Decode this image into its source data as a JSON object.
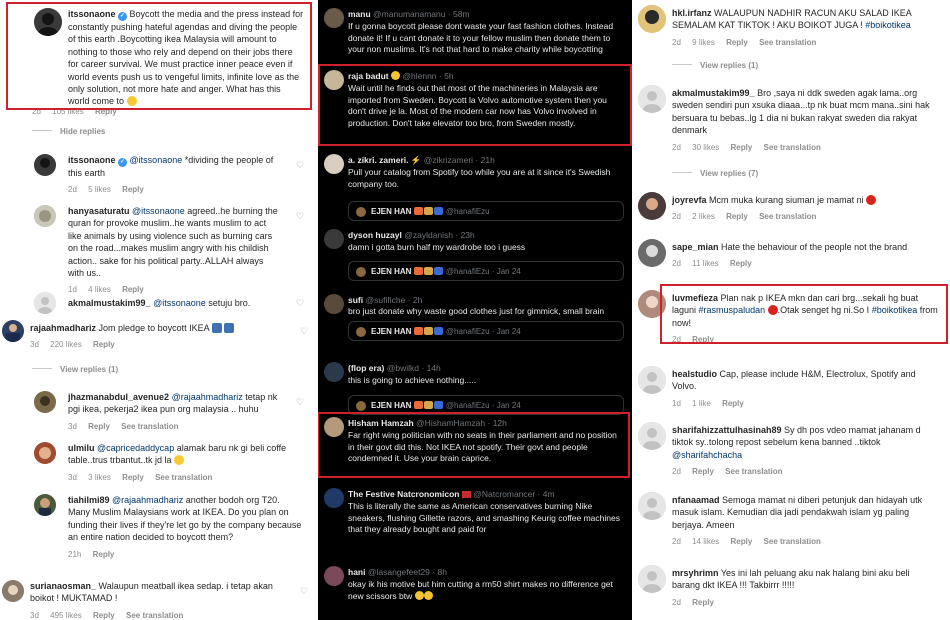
{
  "left": {
    "comments": [
      {
        "user": "itssonaone",
        "verified": true,
        "text": "Boycott the media and the press instead for constantly pushing hateful agendas and diving the people of this earth .Boycotting ikea Malaysia will amount to nothing to those who rely and depend on their jobs there for career survival. We must practice inner peace even if world events push us to vengeful limits, infinite love as the only solution, not more hate and anger. What has this world come to",
        "time": "2d",
        "likes": "105 likes",
        "reply": "Reply"
      },
      {
        "user": "itssonaone",
        "verified": true,
        "mention": "@itssonaone",
        "text": "*dividing the people of this earth",
        "time": "2d",
        "likes": "5 likes",
        "reply": "Reply"
      },
      {
        "user": "hanyasaturatu",
        "mention": "@itssonaone",
        "text": "agreed..he burning the quran for provoke muslim..he wants muslim to act like animals by using violence such as burning cars on the road...makes muslim angry with his childish action.. sake for his political party..ALLAH always with us..",
        "time": "1d",
        "likes": "4 likes",
        "reply": "Reply"
      },
      {
        "user": "akmalmustakim99_",
        "mention": "@itssonaone",
        "text": "setuju bro.",
        "time": "",
        "likes": "",
        "reply": ""
      },
      {
        "user": "rajaahmadhariz",
        "text": "Jom pledge to boycott IKEA",
        "time": "3d",
        "likes": "220 likes",
        "reply": "Reply"
      },
      {
        "user": "jhazmanabdul_avenue2",
        "mention": "@rajaahmadhariz",
        "text": "tetap nk pgi ikea, pekerja2 ikea pun org malaysia .. huhu",
        "time": "3d",
        "likes": "",
        "reply": "Reply",
        "extra": "See translation"
      },
      {
        "user": "ulmilu",
        "mention": "@capricedaddycap",
        "text": "alamak baru nk gi beli coffe table..trus trbantut..tk jd la",
        "time": "3d",
        "likes": "3 likes",
        "reply": "Reply",
        "extra": "See translation"
      },
      {
        "user": "tiahilmi89",
        "mention": "@rajaahmadhariz",
        "text": "another bodoh org T20. Many Muslim Malaysians work at IKEA. Do you plan on funding their lives if they're let go by the company because an entire nation decided to boycott them?",
        "time": "21h",
        "likes": "",
        "reply": "Reply"
      },
      {
        "user": "surianaosman_",
        "text": "Walaupun meatball ikea sedap. i tetap akan boikot ! MUKTAMAD !",
        "time": "3d",
        "likes": "495 likes",
        "reply": "Reply",
        "extra": "See translation"
      }
    ],
    "hide_replies": "Hide replies",
    "view_replies": "View replies (1)"
  },
  "mid": {
    "tweets": [
      {
        "name": "manu",
        "handle": "@manumanamanu",
        "time": "58m",
        "text": "If u gonna boycott please dont waste your fast fashion clothes. Instead donate it! If u cant donate it to your fellow muslim then donate them to your non muslims. It's not that hard to make charity while boycotting"
      },
      {
        "name": "raja badut",
        "handle": "@hlennn",
        "time": "5h",
        "text": "Wait until he finds out that most of the machineries in Malaysia are imported from Sweden. Boycott la Volvo automotive system then you don't drive je la. Most of the modern car now has Volvo involved in production. Don't take elevator too bro, from Sweden mostly."
      },
      {
        "name": "a. zikri. zameri.",
        "handle": "@zikrizameri",
        "time": "21h",
        "text": "Pull your catalog from Spotify too while you are at it since it's Swedish company too."
      },
      {
        "name": "dyson huzayl",
        "handle": "@zayldanish",
        "time": "23h",
        "text": "damn i gotta burn half my wardrobe too i guess"
      },
      {
        "name": "sufi",
        "handle": "@sufifiche",
        "time": "2h",
        "text": "bro just donate why waste good clothes just for gimmick, small brain"
      },
      {
        "name": "(flop era)",
        "handle": "@bwilkd",
        "time": "14h",
        "text": "this is going to achieve nothing....."
      },
      {
        "name": "Hisham Hamzah",
        "handle": "@HishamHamzah",
        "time": "12h",
        "text": "Far right wing politician with no seats in their parliament and no position in their govt did this. Not IKEA not spotify. Their govt and people condemned it. Use your brain caprice."
      },
      {
        "name": "The Festive Natcronomicon",
        "handle": "@Natcromancer",
        "time": "4m",
        "text": "This is literally the same as American conservatives burning Nike sneakers, flushing Gillette razors, and smashing Keurig coffee machines that they already bought and paid for"
      },
      {
        "name": "hani",
        "handle": "@lasangefeet29",
        "time": "8h",
        "text": "okay ik his motive but him cutting a rm50 shirt makes no difference get new scissors btw"
      }
    ],
    "quote": {
      "name": "EJEN HAN",
      "handle": "@hanafiEzu",
      "time": "Jan 24"
    }
  },
  "right": {
    "comments": [
      {
        "user": "hkl.irfanz",
        "text": "WALAUPUN NADHIR RACUN AKU SALAD IKEA SEMALAM KAT TIKTOK ! AKU BOIKOT JUGA !",
        "tag": "#boikotikea",
        "time": "2d",
        "likes": "9 likes",
        "reply": "Reply",
        "extra": "See translation"
      },
      {
        "user": "akmalmustakim99_",
        "text": "Bro ,saya ni ddk sweden agak lama..org sweden sendiri pun xsuka diaaa...tp nk buat mcm mana..sini hak bersuara tu bebas..lg 1 dia ni bukan rakyat sweden dia rakyat denmark",
        "time": "2d",
        "likes": "30 likes",
        "reply": "Reply",
        "extra": "See translation"
      },
      {
        "user": "joyrevfa",
        "text": "Mcm muka kurang siuman je mamat ni",
        "time": "2d",
        "likes": "2 likes",
        "reply": "Reply",
        "extra": "See translation"
      },
      {
        "user": "sape_mian",
        "text": "Hate the behaviour of the people not the brand",
        "time": "2d",
        "likes": "11 likes",
        "reply": "Reply"
      },
      {
        "user": "luvmefieza",
        "text": "Plan nak p IKEA mkn dan cari brg...sekali hg buat laguni",
        "tag": "#rasmuspaludan",
        "text2": ".Otak senget hg ni.So I",
        "tag2": "#boikotikea",
        "text3": "from now!",
        "time": "2d",
        "likes": "",
        "reply": "Reply"
      },
      {
        "user": "healstudio",
        "text": "Cap, please include H&M, Electrolux, Spotify and Volvo.",
        "time": "1d",
        "likes": "1 like",
        "reply": "Reply"
      },
      {
        "user": "sharifahizzattulhasinah89",
        "text": "Sy dh pos vdeo mamat jahanam d tiktok sy..tolong repost sebelum kena banned ..tiktok",
        "mention": "@sharifahchacha",
        "time": "2d",
        "likes": "",
        "reply": "Reply",
        "extra": "See translation"
      },
      {
        "user": "nfanaamad",
        "text": "Semoga mamat ni diberi petunjuk dan hidayah utk masuk islam. Kemudian dia jadi pendakwah islam yg paling berjaya. Ameen",
        "time": "2d",
        "likes": "14 likes",
        "reply": "Reply",
        "extra": "See translation"
      },
      {
        "user": "mrsyhrimn",
        "text": "Yes ini lah peluang aku nak halang bini aku beli barang dkt IKEA !!! Takbirrr !!!!!",
        "time": "2d",
        "likes": "",
        "reply": "Reply"
      }
    ],
    "view_replies_1": "View replies (1)",
    "view_replies_7": "View replies (7)"
  },
  "colors": {
    "highlight_red": "#d0202a",
    "link_blue": "#00376b",
    "twitter_bg": "#000000"
  }
}
